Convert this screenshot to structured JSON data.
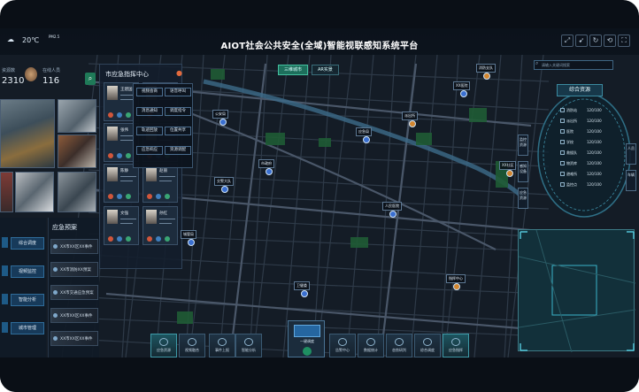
{
  "header": {
    "weather_temp": "20℃",
    "pm_label": "PM2.5",
    "title": "AIOT社会公共安全(全域)智能视联感知系统平台"
  },
  "stats": {
    "left_label": "资源数",
    "left_value": "2310",
    "right_label": "在线人员",
    "right_value": "116"
  },
  "emergency": {
    "title": "应急预案",
    "items": [
      "XX市XX区XX事件",
      "XX市消防XX预案",
      "XX市交通应急预案",
      "XX市XX区XX事件",
      "XX市XX区XX事件"
    ]
  },
  "left_buttons": [
    "综合调度",
    "视频监控",
    "智能分析",
    "城市管理"
  ],
  "command_center": {
    "title": "市应急指挥中心",
    "persons": [
      {
        "name": "王建国"
      },
      {
        "name": "李明"
      },
      {
        "name": "张伟"
      },
      {
        "name": "刘洋"
      },
      {
        "name": "陈静"
      },
      {
        "name": "赵丽"
      },
      {
        "name": "文强"
      },
      {
        "name": "孙红"
      }
    ]
  },
  "menu": {
    "items": [
      "视频会商",
      "语音呼叫",
      "消息通知",
      "调度指令",
      "轨迹回放",
      "位置共享",
      "应急响应",
      "资源调配"
    ]
  },
  "map_tabs": [
    "三维城市",
    "AR实景"
  ],
  "map_labels": [
    "消防支队",
    "公安局",
    "应急局",
    "派出所",
    "交警大队",
    "市政府",
    "城管局",
    "人民医院",
    "指挥中心",
    "卫健委",
    "XX社区",
    "XX医院"
  ],
  "right_panel": {
    "search_placeholder": "请输入关键词搜索",
    "title": "综合资源",
    "rows": [
      {
        "name": "消防站",
        "value": "120/100"
      },
      {
        "name": "派出所",
        "value": "120/100"
      },
      {
        "name": "医院",
        "value": "120/100"
      },
      {
        "name": "学校",
        "value": "120/100"
      },
      {
        "name": "救援队",
        "value": "120/100"
      },
      {
        "name": "物资库",
        "value": "120/100"
      },
      {
        "name": "避难所",
        "value": "120/100"
      },
      {
        "name": "监控点",
        "value": "120/100"
      }
    ],
    "side_left": [
      "监控资源",
      "感知设备",
      "应急资源"
    ],
    "side_right": [
      "人员",
      "车辆"
    ]
  },
  "bottom_tabs": [
    "应急资源",
    "视频融合",
    "事件上报",
    "智能分析",
    "",
    "告警中心",
    "数据统计",
    "态势研判",
    "综合调度",
    "应急指挥"
  ],
  "bottom_center": {
    "label": "一键调度"
  },
  "colors": {
    "accent": "#2fb38a",
    "panel": "#131e2c",
    "map_bg": "#141c26",
    "road": "#3a4656",
    "river": "#3c6b8a",
    "park": "#1f5c35"
  }
}
